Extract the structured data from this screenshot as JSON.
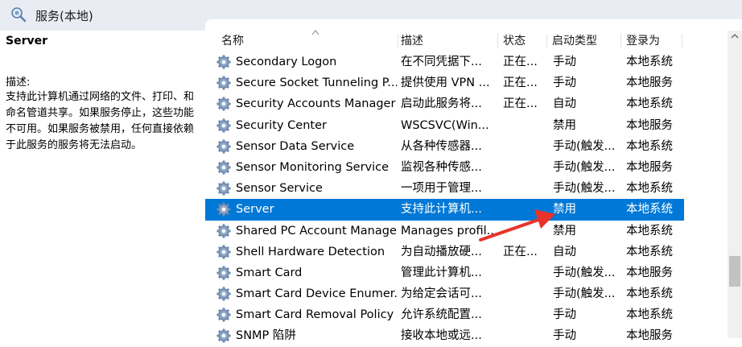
{
  "header": {
    "title": "服务(本地)"
  },
  "detail": {
    "service_name": "Server",
    "description_label": "描述:",
    "description_text": "支持此计算机通过网络的文件、打印、和命名管道共享。如果服务停止，这些功能不可用。如果服务被禁用，任何直接依赖于此服务的服务将无法启动。"
  },
  "columns": {
    "name": "名称",
    "description": "描述",
    "status": "状态",
    "startup_type": "启动类型",
    "logon_as": "登录为"
  },
  "services": [
    {
      "name": "Secondary Logon",
      "description": "在不同凭据下...",
      "status": "正在...",
      "startup": "手动",
      "logon": "本地系统"
    },
    {
      "name": "Secure Socket Tunneling P...",
      "description": "提供使用 VPN ...",
      "status": "正在...",
      "startup": "手动",
      "logon": "本地服务"
    },
    {
      "name": "Security Accounts Manager",
      "description": "启动此服务将...",
      "status": "正在...",
      "startup": "自动",
      "logon": "本地系统"
    },
    {
      "name": "Security Center",
      "description": "WSCSVC(Win...",
      "status": "",
      "startup": "禁用",
      "logon": "本地服务"
    },
    {
      "name": "Sensor Data Service",
      "description": "从各种传感器...",
      "status": "",
      "startup": "手动(触发...",
      "logon": "本地系统"
    },
    {
      "name": "Sensor Monitoring Service",
      "description": "监视各种传感...",
      "status": "",
      "startup": "手动(触发...",
      "logon": "本地服务"
    },
    {
      "name": "Sensor Service",
      "description": "一项用于管理...",
      "status": "",
      "startup": "手动(触发...",
      "logon": "本地系统"
    },
    {
      "name": "Server",
      "description": "支持此计算机...",
      "status": "",
      "startup": "禁用",
      "logon": "本地系统",
      "selected": true
    },
    {
      "name": "Shared PC Account Manager",
      "description": "Manages profil...",
      "status": "",
      "startup": "禁用",
      "logon": "本地系统"
    },
    {
      "name": "Shell Hardware Detection",
      "description": "为自动播放硬...",
      "status": "正在...",
      "startup": "自动",
      "logon": "本地系统"
    },
    {
      "name": "Smart Card",
      "description": "管理此计算机...",
      "status": "",
      "startup": "手动(触发...",
      "logon": "本地服务"
    },
    {
      "name": "Smart Card Device Enumer...",
      "description": "为给定会话可...",
      "status": "",
      "startup": "手动(触发...",
      "logon": "本地系统"
    },
    {
      "name": "Smart Card Removal Policy",
      "description": "允许系统配置...",
      "status": "",
      "startup": "手动",
      "logon": "本地系统"
    },
    {
      "name": "SNMP 陷阱",
      "description": "接收本地或远...",
      "status": "",
      "startup": "手动",
      "logon": "本地服务"
    }
  ],
  "colors": {
    "selection": "#0078d7",
    "header_bg": "#e9edf3",
    "annotation_arrow": "#e8332a"
  }
}
